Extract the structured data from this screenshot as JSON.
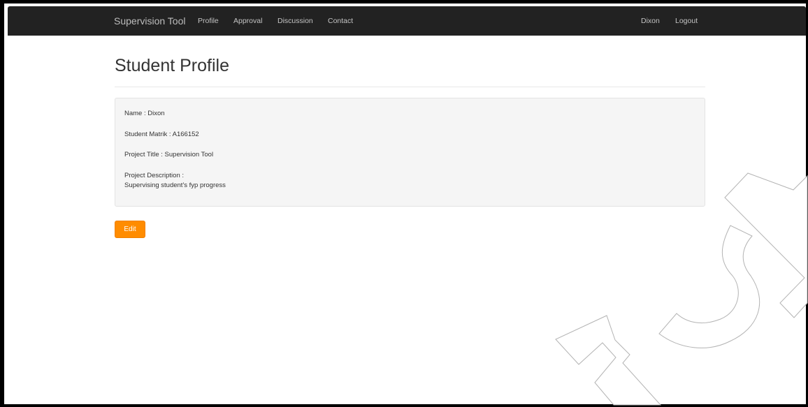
{
  "navbar": {
    "brand": "Supervision Tool",
    "links": [
      "Profile",
      "Approval",
      "Discussion",
      "Contact"
    ],
    "user": "Dixon",
    "logout": "Logout"
  },
  "page": {
    "title": "Student Profile"
  },
  "profile": {
    "name": "Name : Dixon",
    "matrik": "Student Matrik : A166152",
    "project_title": "Project Title : Supervision Tool",
    "description_label": "Project Description :",
    "description_value": "Supervising student's fyp progress"
  },
  "actions": {
    "edit_label": "Edit"
  },
  "watermark": {
    "text": "TSM",
    "color": "#b3b3b3"
  }
}
